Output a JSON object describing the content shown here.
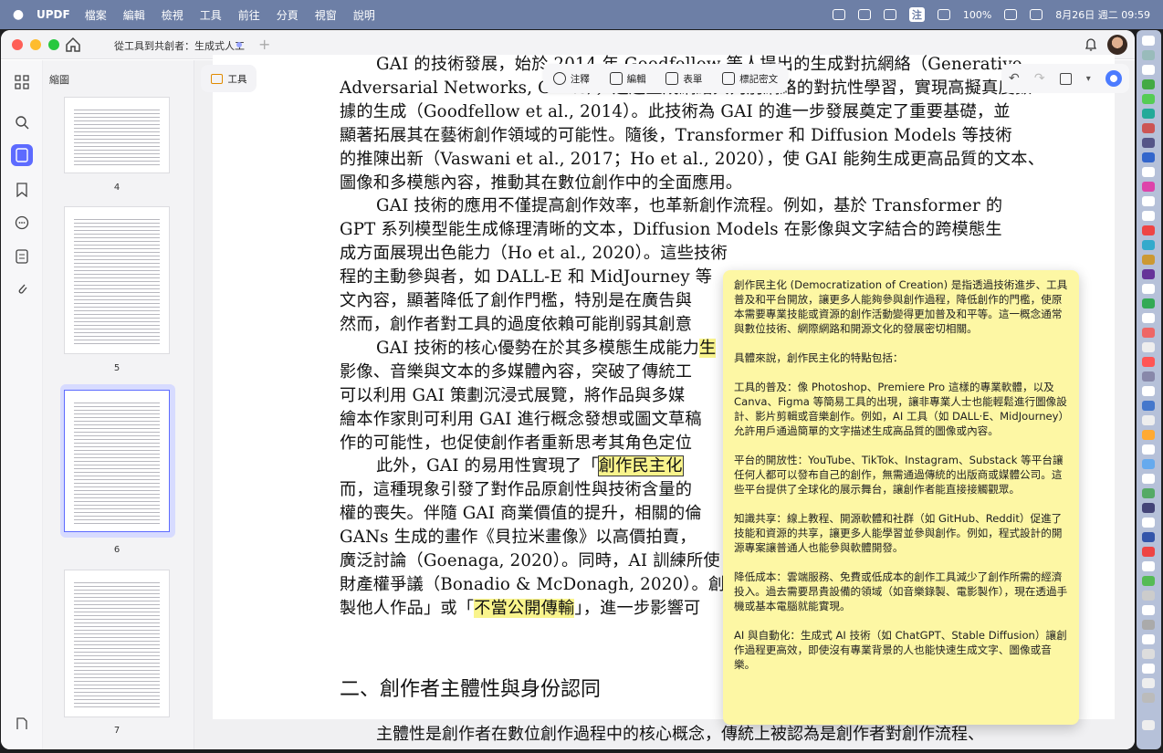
{
  "menubar": {
    "app": "UPDF",
    "items": [
      "檔案",
      "編輯",
      "檢視",
      "工具",
      "前往",
      "分頁",
      "視窗",
      "說明"
    ],
    "status": {
      "battery": "100%",
      "badge": "注",
      "datetime": "8月26日 週二 09:59"
    }
  },
  "window": {
    "tab_title": "從工具到共創者：生成式人工"
  },
  "sidebar": {
    "thumbs_title": "縮圖",
    "page_numbers": [
      "4",
      "5",
      "6",
      "7"
    ]
  },
  "toolbar": {
    "tool_label": "工具",
    "buttons": [
      {
        "label": "注釋",
        "icon": "comment-icon"
      },
      {
        "label": "編輯",
        "icon": "edit-icon"
      },
      {
        "label": "表單",
        "icon": "form-icon"
      },
      {
        "label": "標記密文",
        "icon": "redact-icon"
      }
    ]
  },
  "document": {
    "lines": [
      "GAI 的技術發展，始於 2014 年 Goodfellow 等人提出的生成對抗網絡（Generative",
      "Adversarial Networks, GANs），透過生成網絡與判別網絡的對抗性學習，實現高擬真度數",
      "據的生成（Goodfellow et al., 2014）。此技術為 GAI 的進一步發展奠定了重要基礎，並",
      "顯著拓展其在藝術創作領域的可能性。隨後，Transformer 和 Diffusion Models 等技術",
      "的推陳出新（Vaswani et al., 2017；Ho et al., 2020），使 GAI 能夠生成更高品質的文本、",
      "圖像和多模態內容，推動其在數位創作中的全面應用。",
      "GAI 技術的應用不僅提高創作效率，也革新創作流程。例如，基於 Transformer 的",
      "GPT 系列模型能生成條理清晰的文本，Diffusion Models 在影像與文字結合的跨模態生",
      "成方面展現出色能力（Ho et al., 2020）。這些技術",
      "程的主動參與者，如 DALL-E 和 MidJourney 等",
      "文內容，顯著降低了創作門檻，特別是在廣告與",
      "然而，創作者對工具的過度依賴可能削弱其創意",
      "GAI 技術的核心優勢在於其多模態生成能力",
      "影像、音樂與文本的多媒體內容，突破了傳統工",
      "可以利用 GAI 策劃沉浸式展覽，將作品與多媒",
      "繪本作家則可利用 GAI 進行概念發想或圖文草稿",
      "作的可能性，也促使創作者重新思考其角色定位",
      "此外，GAI 的易用性實現了「",
      "而，這種現象引發了對作品原創性與技術含量的",
      "權的喪失。伴隨 GAI 商業價值的提升，相關的倫",
      "GANs 生成的畫作《貝拉米畫像》以高價拍賣，",
      "廣泛討論（Goenaga, 2020）。同時，AI 訓練所使",
      "財產權爭議（Bonadio & McDonagh, 2020）。創作者",
      "製他人作品」或「"
    ],
    "highlight_box": "創作民主化",
    "highlight_small": "生",
    "highlight_phrase": "不當公開傳輸",
    "after_phrase": "」，進一步影響可",
    "heading": "二、創作者主體性與身份認同",
    "bottom_line": "主體性是創作者在數位創作過程中的核心概念，傳統上被認為是創作者對創作流程、"
  },
  "note": {
    "paragraphs": [
      "創作民主化 (Democratization of Creation) 是指透過技術進步、工具普及和平台開放，讓更多人能夠參與創作過程，降低創作的門檻，使原本需要專業技能或資源的創作活動變得更加普及和平等。這一概念通常與數位技術、網際網路和開源文化的發展密切相關。",
      "具體來說，創作民主化的特點包括：",
      "工具的普及：像 Photoshop、Premiere Pro 這樣的專業軟體，以及 Canva、Figma 等簡易工具的出現，讓非專業人士也能輕鬆進行圖像設計、影片剪輯或音樂創作。例如，AI 工具（如 DALL·E、MidJourney）允許用戶通過簡單的文字描述生成高品質的圖像或內容。",
      "平台的開放性：YouTube、TikTok、Instagram、Substack 等平台讓任何人都可以發布自己的創作，無需通過傳統的出版商或媒體公司。這些平台提供了全球化的展示舞台，讓創作者能直接接觸觀眾。",
      "知識共享：線上教程、開源軟體和社群（如 GitHub、Reddit）促進了技能和資源的共享，讓更多人能學習並參與創作。例如，程式設計的開源專案讓普通人也能參與軟體開發。",
      "降低成本：雲端服務、免費或低成本的創作工具減少了創作所需的經濟投入。過去需要昂貴設備的領域（如音樂錄製、電影製作），現在透過手機或基本電腦就能實現。",
      "AI 與自動化：生成式 AI 技術（如 ChatGPT、Stable Diffusion）讓創作過程更高效，即使沒有專業背景的人也能快速生成文字、圖像或音樂。"
    ]
  }
}
